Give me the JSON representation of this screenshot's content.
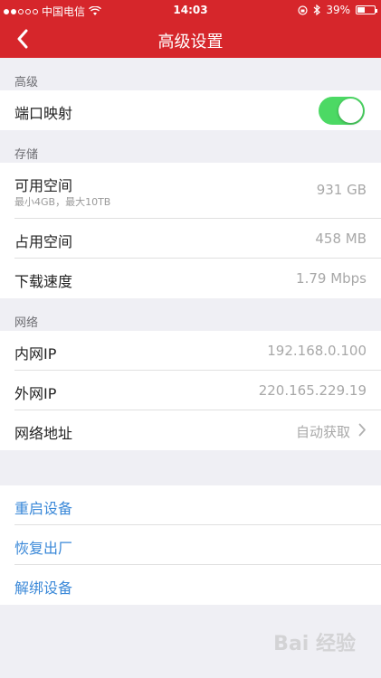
{
  "status_bar": {
    "carrier": "中国电信",
    "time": "14:03",
    "battery": "39%"
  },
  "nav": {
    "title": "高级设置"
  },
  "sections": {
    "advanced": {
      "title": "高级",
      "port_mapping": {
        "label": "端口映射",
        "enabled": true
      }
    },
    "storage": {
      "title": "存储",
      "available": {
        "label": "可用空间",
        "sub": "最小4GB，最大10TB",
        "value": "931 GB"
      },
      "used": {
        "label": "占用空间",
        "value": "458 MB"
      },
      "download_speed": {
        "label": "下载速度",
        "value": "1.79 Mbps"
      }
    },
    "network": {
      "title": "网络",
      "lan_ip": {
        "label": "内网IP",
        "value": "192.168.0.100"
      },
      "wan_ip": {
        "label": "外网IP",
        "value": "220.165.229.19"
      },
      "net_address": {
        "label": "网络地址",
        "value": "自动获取"
      }
    },
    "actions": {
      "restart": "重启设备",
      "factory_reset": "恢复出厂",
      "unbind": "解绑设备"
    }
  },
  "watermark": "Bai 经验",
  "colors": {
    "header": "#d6262b",
    "toggle_on": "#4cd964",
    "action_text": "#3a88d8"
  }
}
